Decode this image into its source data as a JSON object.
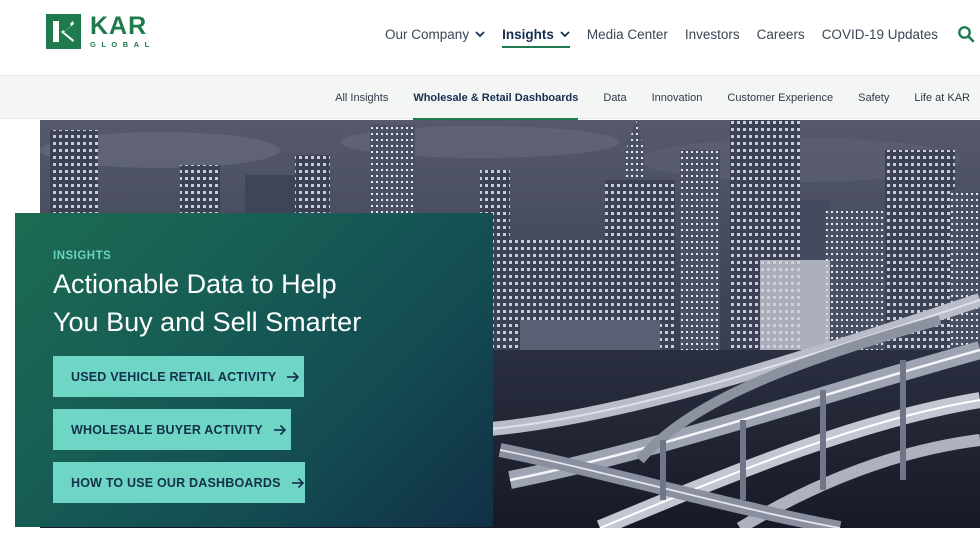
{
  "logo": {
    "word": "KAR",
    "sub": "GLOBAL",
    "mark_icon": "kar-k-logo-icon"
  },
  "main_nav": {
    "items": [
      {
        "label": "Our Company",
        "has_dropdown": true,
        "active": false
      },
      {
        "label": "Insights",
        "has_dropdown": true,
        "active": true
      },
      {
        "label": "Media Center",
        "has_dropdown": false,
        "active": false
      },
      {
        "label": "Investors",
        "has_dropdown": false,
        "active": false
      },
      {
        "label": "Careers",
        "has_dropdown": false,
        "active": false
      },
      {
        "label": "COVID-19 Updates",
        "has_dropdown": false,
        "active": false
      }
    ],
    "search_icon": "search-icon"
  },
  "sub_nav": {
    "items": [
      {
        "label": "All Insights",
        "active": false
      },
      {
        "label": "Wholesale & Retail Dashboards",
        "active": true
      },
      {
        "label": "Data",
        "active": false
      },
      {
        "label": "Innovation",
        "active": false
      },
      {
        "label": "Customer Experience",
        "active": false
      },
      {
        "label": "Safety",
        "active": false
      },
      {
        "label": "Life at KAR",
        "active": false
      }
    ]
  },
  "hero": {
    "eyebrow": "INSIGHTS",
    "heading_line1": "Actionable Data to Help",
    "heading_line2": "You Buy and Sell Smarter",
    "buttons": [
      {
        "label": "USED VEHICLE RETAIL ACTIVITY",
        "icon": "arrow-right-icon"
      },
      {
        "label": "WHOLESALE BUYER ACTIVITY",
        "icon": "arrow-right-icon"
      },
      {
        "label": "HOW TO USE OUR DASHBOARDS",
        "icon": "arrow-right-icon"
      }
    ]
  },
  "colors": {
    "brand_green": "#1f7a4d",
    "accent_teal": "#6fd5c4",
    "navy": "#15304f"
  }
}
